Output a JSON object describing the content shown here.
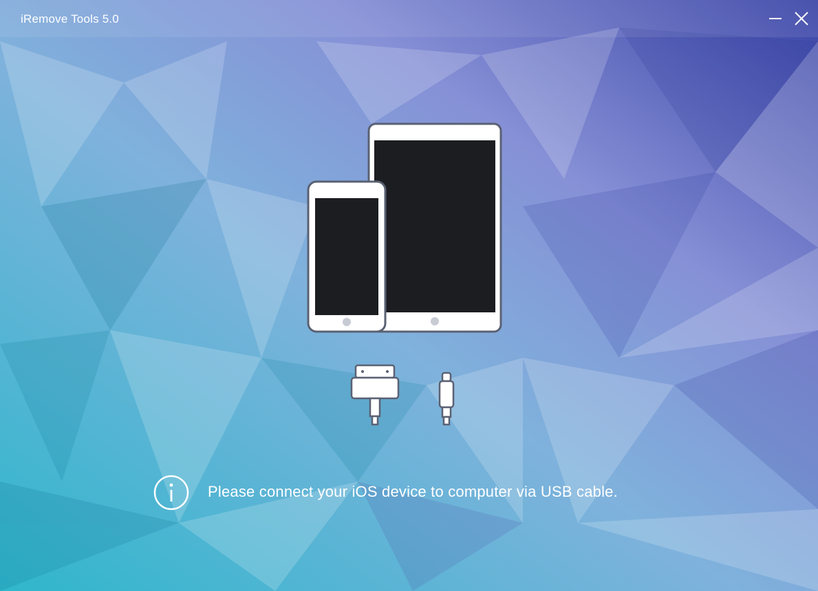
{
  "window": {
    "title": "iRemove Tools  5.0",
    "controls": {
      "minimize": "minimize-icon",
      "close": "close-icon"
    }
  },
  "main": {
    "illustration": {
      "devices": [
        "tablet-icon",
        "phone-icon"
      ],
      "cables": [
        "30-pin-connector-icon",
        "lightning-connector-icon"
      ]
    },
    "message": "Please connect your iOS device to computer via USB cable.",
    "info_icon": "info-icon"
  },
  "colors": {
    "bg_left": "#3fbcd2",
    "bg_mid": "#8c9fd8",
    "bg_right": "#4a56b8",
    "device_screen": "#1c1d21",
    "device_body": "#ffffff",
    "text": "#ffffff"
  }
}
